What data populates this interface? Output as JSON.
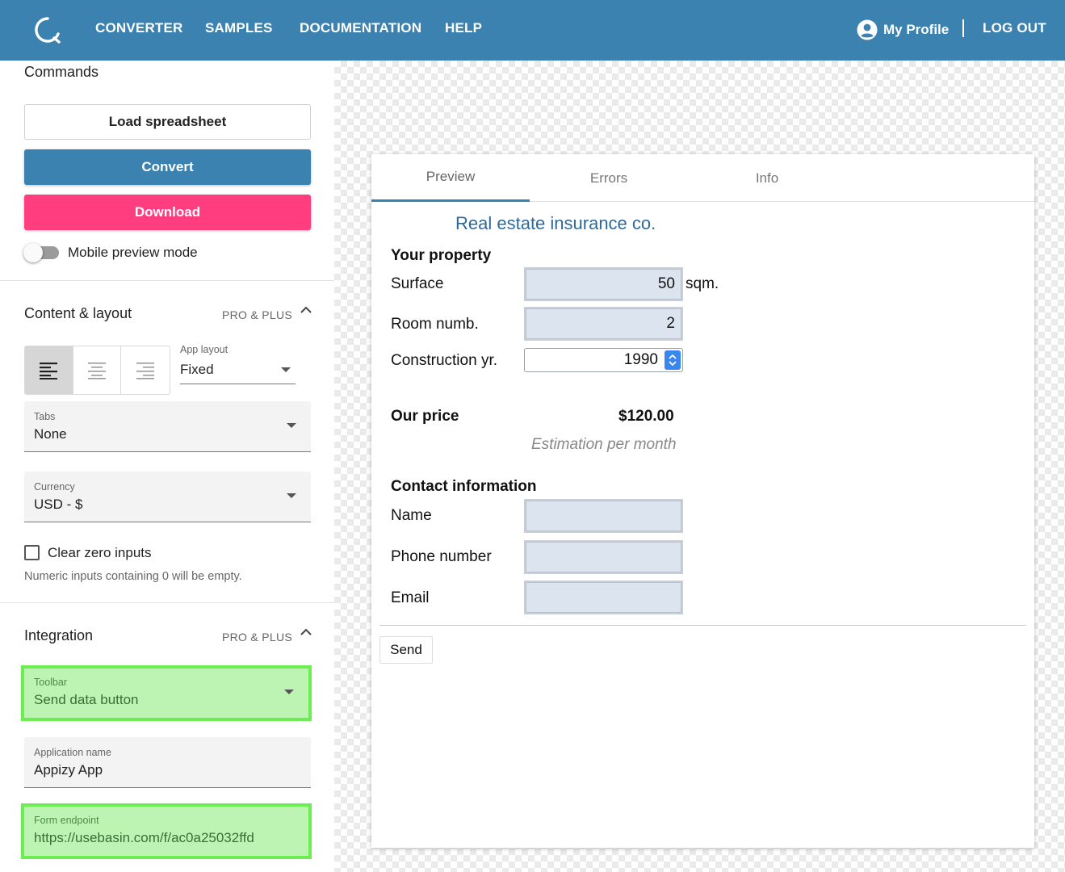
{
  "nav": {
    "items": [
      "CONVERTER",
      "SAMPLES",
      "DOCUMENTATION",
      "HELP"
    ],
    "profile": "My Profile",
    "logout": "LOG OUT"
  },
  "sidebar": {
    "commands": {
      "title": "Commands",
      "load": "Load spreadsheet",
      "convert": "Convert",
      "download": "Download",
      "mobile_preview": "Mobile preview mode"
    },
    "content_layout": {
      "title": "Content & layout",
      "badge": "PRO & PLUS",
      "app_layout_label": "App layout",
      "app_layout_value": "Fixed",
      "tabs_label": "Tabs",
      "tabs_value": "None",
      "currency_label": "Currency",
      "currency_value": "USD - $",
      "clear_zero_label": "Clear zero inputs",
      "clear_zero_hint": "Numeric inputs containing 0 will be empty."
    },
    "integration": {
      "title": "Integration",
      "badge": "PRO & PLUS",
      "toolbar_label": "Toolbar",
      "toolbar_value": "Send data button",
      "app_name_label": "Application name",
      "app_name_value": "Appizy App",
      "endpoint_label": "Form endpoint",
      "endpoint_value": "https://usebasin.com/f/ac0a25032ffd"
    }
  },
  "preview": {
    "tabs": [
      "Preview",
      "Errors",
      "Info"
    ],
    "form": {
      "title": "Real estate insurance co.",
      "property_heading": "Your property",
      "surface_label": "Surface",
      "surface_value": "50",
      "surface_unit": "sqm.",
      "rooms_label": "Room numb.",
      "rooms_value": "2",
      "year_label": "Construction yr.",
      "year_value": "1990",
      "price_label": "Our price",
      "price_value": "$120.00",
      "price_note": "Estimation per month",
      "contact_heading": "Contact information",
      "name_label": "Name",
      "name_value": "",
      "phone_label": "Phone number",
      "phone_value": "",
      "email_label": "Email",
      "email_value": "",
      "send": "Send"
    }
  },
  "colors": {
    "brand": "#3b82b1",
    "download": "#ff3d7f",
    "highlight_fill": "#bdf4b4",
    "highlight_border": "#6cee52"
  }
}
